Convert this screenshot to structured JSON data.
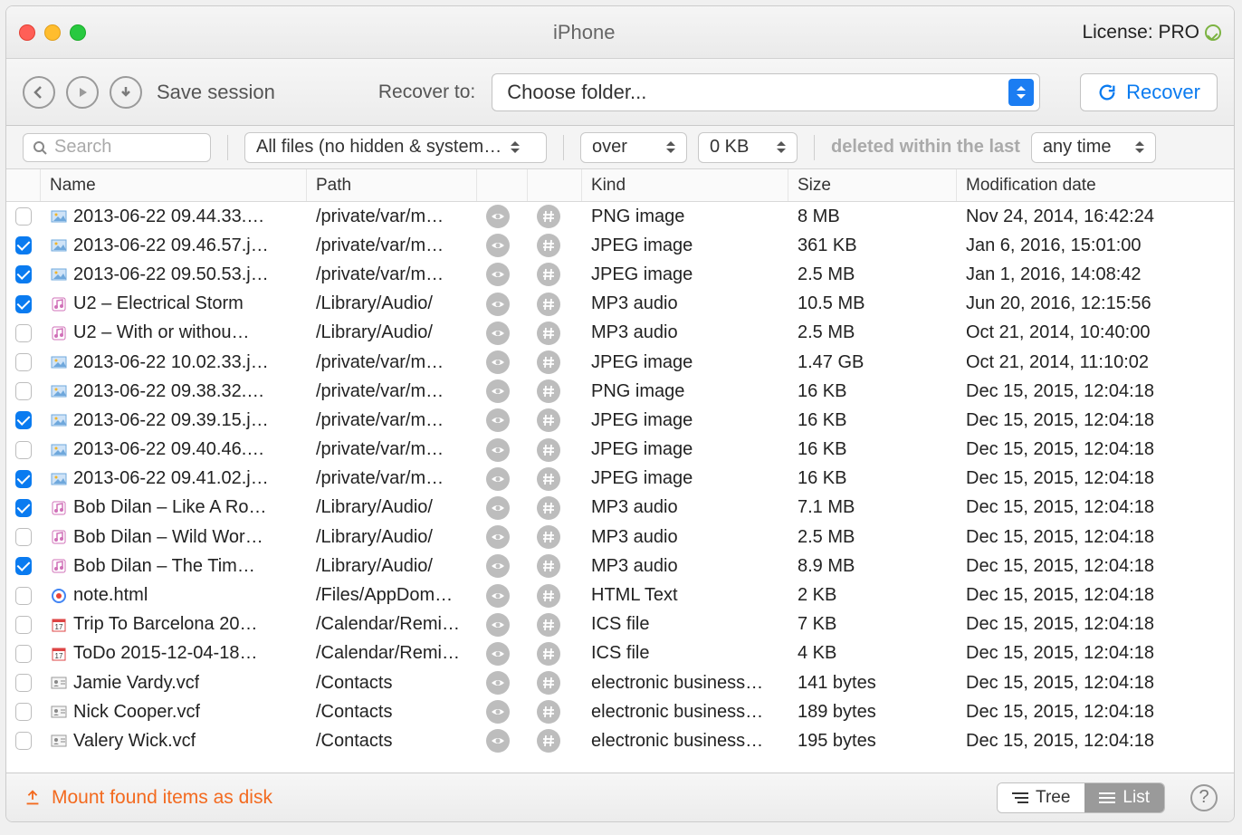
{
  "title": "iPhone",
  "license": "License: PRO",
  "toolbar": {
    "save_session": "Save session",
    "recover_to_label": "Recover to:",
    "folder_placeholder": "Choose folder...",
    "recover_button": "Recover"
  },
  "filter": {
    "search_placeholder": "Search",
    "filetype": "All files (no hidden & system…",
    "size_op": "over",
    "size_value": "0 KB",
    "deleted_label": "deleted within the last",
    "time": "any time"
  },
  "columns": {
    "name": "Name",
    "path": "Path",
    "kind": "Kind",
    "size": "Size",
    "date": "Modification date"
  },
  "rows": [
    {
      "checked": false,
      "icon": "image",
      "name": "2013-06-22 09.44.33.…",
      "path": "/private/var/m…",
      "kind": "PNG image",
      "size": "8 MB",
      "date": "Nov 24, 2014, 16:42:24"
    },
    {
      "checked": true,
      "icon": "image",
      "name": "2013-06-22 09.46.57.j…",
      "path": "/private/var/m…",
      "kind": "JPEG image",
      "size": "361 KB",
      "date": "Jan 6, 2016, 15:01:00"
    },
    {
      "checked": true,
      "icon": "image",
      "name": "2013-06-22 09.50.53.j…",
      "path": "/private/var/m…",
      "kind": "JPEG image",
      "size": "2.5 MB",
      "date": "Jan 1, 2016, 14:08:42"
    },
    {
      "checked": true,
      "icon": "audio",
      "name": "U2 – Electrical Storm",
      "path": "/Library/Audio/",
      "kind": "MP3 audio",
      "size": "10.5 MB",
      "date": "Jun 20, 2016, 12:15:56"
    },
    {
      "checked": false,
      "icon": "audio",
      "name": "U2 – With or withou…",
      "path": "/Library/Audio/",
      "kind": "MP3 audio",
      "size": "2.5 MB",
      "date": "Oct 21, 2014, 10:40:00"
    },
    {
      "checked": false,
      "icon": "image",
      "name": "2013-06-22 10.02.33.j…",
      "path": "/private/var/m…",
      "kind": "JPEG image",
      "size": "1.47 GB",
      "date": "Oct 21, 2014, 11:10:02"
    },
    {
      "checked": false,
      "icon": "image",
      "name": "2013-06-22 09.38.32.…",
      "path": "/private/var/m…",
      "kind": "PNG image",
      "size": "16 KB",
      "date": "Dec 15, 2015, 12:04:18"
    },
    {
      "checked": true,
      "icon": "image",
      "name": "2013-06-22 09.39.15.j…",
      "path": "/private/var/m…",
      "kind": "JPEG image",
      "size": "16 KB",
      "date": "Dec 15, 2015, 12:04:18"
    },
    {
      "checked": false,
      "icon": "image",
      "name": "2013-06-22 09.40.46.…",
      "path": "/private/var/m…",
      "kind": "JPEG image",
      "size": "16 KB",
      "date": "Dec 15, 2015, 12:04:18"
    },
    {
      "checked": true,
      "icon": "image",
      "name": "2013-06-22 09.41.02.j…",
      "path": "/private/var/m…",
      "kind": "JPEG image",
      "size": "16 KB",
      "date": "Dec 15, 2015, 12:04:18"
    },
    {
      "checked": true,
      "icon": "audio",
      "name": "Bob Dilan – Like A Ro…",
      "path": "/Library/Audio/",
      "kind": "MP3 audio",
      "size": "7.1 MB",
      "date": "Dec 15, 2015, 12:04:18"
    },
    {
      "checked": false,
      "icon": "audio",
      "name": "Bob Dilan – Wild Wor…",
      "path": "/Library/Audio/",
      "kind": "MP3 audio",
      "size": "2.5 MB",
      "date": "Dec 15, 2015, 12:04:18"
    },
    {
      "checked": true,
      "icon": "audio",
      "name": "Bob Dilan – The Tim…",
      "path": "/Library/Audio/",
      "kind": "MP3 audio",
      "size": "8.9 MB",
      "date": "Dec 15, 2015, 12:04:18"
    },
    {
      "checked": false,
      "icon": "html",
      "name": "note.html",
      "path": "/Files/AppDom…",
      "kind": "HTML Text",
      "size": "2 KB",
      "date": "Dec 15, 2015, 12:04:18"
    },
    {
      "checked": false,
      "icon": "ics",
      "name": "Trip To Barcelona 20…",
      "path": "/Calendar/Remi…",
      "kind": "ICS file",
      "size": "7 KB",
      "date": "Dec 15, 2015, 12:04:18"
    },
    {
      "checked": false,
      "icon": "ics",
      "name": "ToDo 2015-12-04-18…",
      "path": "/Calendar/Remi…",
      "kind": "ICS file",
      "size": "4 KB",
      "date": "Dec 15, 2015, 12:04:18"
    },
    {
      "checked": false,
      "icon": "vcf",
      "name": "Jamie Vardy.vcf",
      "path": "/Contacts",
      "kind": "electronic business…",
      "size": "141 bytes",
      "date": "Dec 15, 2015, 12:04:18"
    },
    {
      "checked": false,
      "icon": "vcf",
      "name": "Nick Cooper.vcf",
      "path": "/Contacts",
      "kind": "electronic business…",
      "size": "189 bytes",
      "date": "Dec 15, 2015, 12:04:18"
    },
    {
      "checked": false,
      "icon": "vcf",
      "name": "Valery Wick.vcf",
      "path": "/Contacts",
      "kind": "electronic business…",
      "size": "195 bytes",
      "date": "Dec 15, 2015, 12:04:18"
    }
  ],
  "footer": {
    "mount": "Mount found items as disk",
    "tree": "Tree",
    "list": "List"
  }
}
